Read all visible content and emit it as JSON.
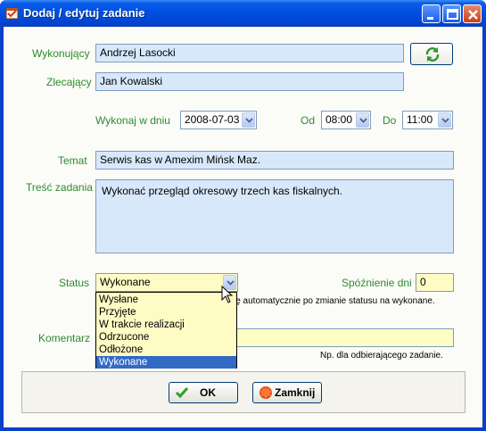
{
  "window": {
    "title": "Dodaj / edytuj zadanie"
  },
  "form": {
    "wykonujacy": {
      "label": "Wykonujący",
      "value": "Andrzej Lasocki"
    },
    "zlecajacy": {
      "label": "Zlecający",
      "value": "Jan Kowalski"
    },
    "wykonaj_w_dniu": {
      "label": "Wykonaj w dniu",
      "value": "2008-07-03"
    },
    "od": {
      "label": "Od",
      "value": "08:00"
    },
    "do": {
      "label": "Do",
      "value": "11:00"
    },
    "temat": {
      "label": "Temat",
      "value": "Serwis kas w Amexim Mińsk Maz."
    },
    "tresc": {
      "label": "Treść zadania",
      "value": "Wykonać przegląd okresowy trzech kas fiskalnych."
    },
    "status": {
      "label": "Status",
      "value": "Wykonane",
      "options": [
        "Wysłane",
        "Przyjęte",
        "W trakcie realizacji",
        "Odrzucone",
        "Odłożone",
        "Wykonane"
      ],
      "selected_index": 5
    },
    "spoznienie": {
      "label": "Spóźnienie dni",
      "value": "0"
    },
    "auto_hint": "ię automatycznie po zmianie statusu na wykonane.",
    "komentarz": {
      "label": "Komentarz",
      "value": ""
    },
    "komentarz_hint": "Np. dla odbierającego zadanie."
  },
  "buttons": {
    "ok": "OK",
    "close": "Zamknij"
  },
  "icons": {
    "app": "app-icon",
    "refresh": "refresh-icon",
    "ok": "checkmark-icon",
    "close": "stop-icon"
  },
  "colors": {
    "label_green": "#2e8a2e",
    "field_blue": "#d8e8fb",
    "field_yellow": "#fefbc4",
    "selection": "#316ac5",
    "titlebar": "#0050e0"
  }
}
